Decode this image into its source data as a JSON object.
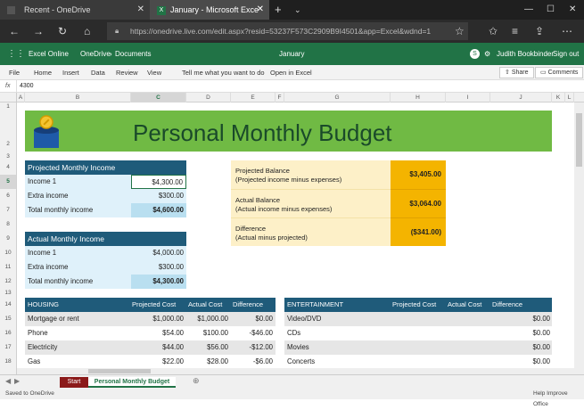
{
  "browser": {
    "tabs": [
      {
        "label": "Recent - OneDrive"
      },
      {
        "label": "January - Microsoft Exce"
      }
    ],
    "url": "https://onedrive.live.com/edit.aspx?resid=53237F573C2909B9I4501&app=Excel&wdnd=1"
  },
  "app": {
    "name": "Excel Online",
    "breadcrumb_root": "OneDrive",
    "breadcrumb_sep": "›",
    "breadcrumb_folder": "Documents",
    "doc_title": "January",
    "user": "Judith Bookbinder",
    "signout": "Sign out"
  },
  "menu": {
    "items": [
      "File",
      "Home",
      "Insert",
      "Data",
      "Review",
      "View"
    ],
    "tell_me": "Tell me what you want to do",
    "open_in_excel": "Open in Excel",
    "share": "Share",
    "comments": "Comments"
  },
  "formula_bar": {
    "fx": "fx",
    "value": "4300"
  },
  "columns": [
    "A",
    "B",
    "C",
    "D",
    "E",
    "F",
    "G",
    "H",
    "I",
    "J",
    "K",
    "L"
  ],
  "rows": [
    "1",
    "2",
    "3",
    "4",
    "5",
    "6",
    "7",
    "8",
    "9",
    "10",
    "11",
    "12",
    "13",
    "14",
    "15",
    "16",
    "17",
    "18"
  ],
  "title": "Personal Monthly Budget",
  "projected": {
    "header": "Projected Monthly Income",
    "rows": [
      {
        "label": "Income 1",
        "value": "$4,300.00"
      },
      {
        "label": "Extra income",
        "value": "$300.00"
      },
      {
        "label": "Total monthly income",
        "value": "$4,600.00"
      }
    ]
  },
  "actual": {
    "header": "Actual Monthly Income",
    "rows": [
      {
        "label": "Income 1",
        "value": "$4,000.00"
      },
      {
        "label": "Extra income",
        "value": "$300.00"
      },
      {
        "label": "Total monthly income",
        "value": "$4,300.00"
      }
    ]
  },
  "balances": [
    {
      "line1": "Projected Balance",
      "line2": "(Projected income minus expenses)",
      "value": "$3,405.00"
    },
    {
      "line1": "Actual Balance",
      "line2": "(Actual income minus expenses)",
      "value": "$3,064.00"
    },
    {
      "line1": "Difference",
      "line2": "(Actual minus projected)",
      "value": "($341.00)"
    }
  ],
  "housing": {
    "header": "HOUSING",
    "col_projected": "Projected Cost",
    "col_actual": "Actual Cost",
    "col_diff": "Difference",
    "rows": [
      {
        "label": "Mortgage or rent",
        "projected": "$1,000.00",
        "actual": "$1,000.00",
        "diff": "$0.00"
      },
      {
        "label": "Phone",
        "projected": "$54.00",
        "actual": "$100.00",
        "diff": "-$46.00"
      },
      {
        "label": "Electricity",
        "projected": "$44.00",
        "actual": "$56.00",
        "diff": "-$12.00"
      },
      {
        "label": "Gas",
        "projected": "$22.00",
        "actual": "$28.00",
        "diff": "-$6.00"
      }
    ]
  },
  "entertainment": {
    "header": "ENTERTAINMENT",
    "col_projected": "Projected Cost",
    "col_actual": "Actual Cost",
    "col_diff": "Difference",
    "rows": [
      {
        "label": "Video/DVD",
        "diff": "$0.00"
      },
      {
        "label": "CDs",
        "diff": "$0.00"
      },
      {
        "label": "Movies",
        "diff": "$0.00"
      },
      {
        "label": "Concerts",
        "diff": "$0.00"
      }
    ]
  },
  "sheets": [
    {
      "label": "Start"
    },
    {
      "label": "Personal Monthly Budget"
    }
  ],
  "status": {
    "left": "Saved to OneDrive",
    "right": "Help Improve Office"
  },
  "colors": {
    "excel_green": "#217346",
    "banner_green": "#70ba44",
    "header_blue": "#1f5b7a",
    "balance_gold": "#f4b400",
    "start_tab": "#8b1a1a"
  }
}
